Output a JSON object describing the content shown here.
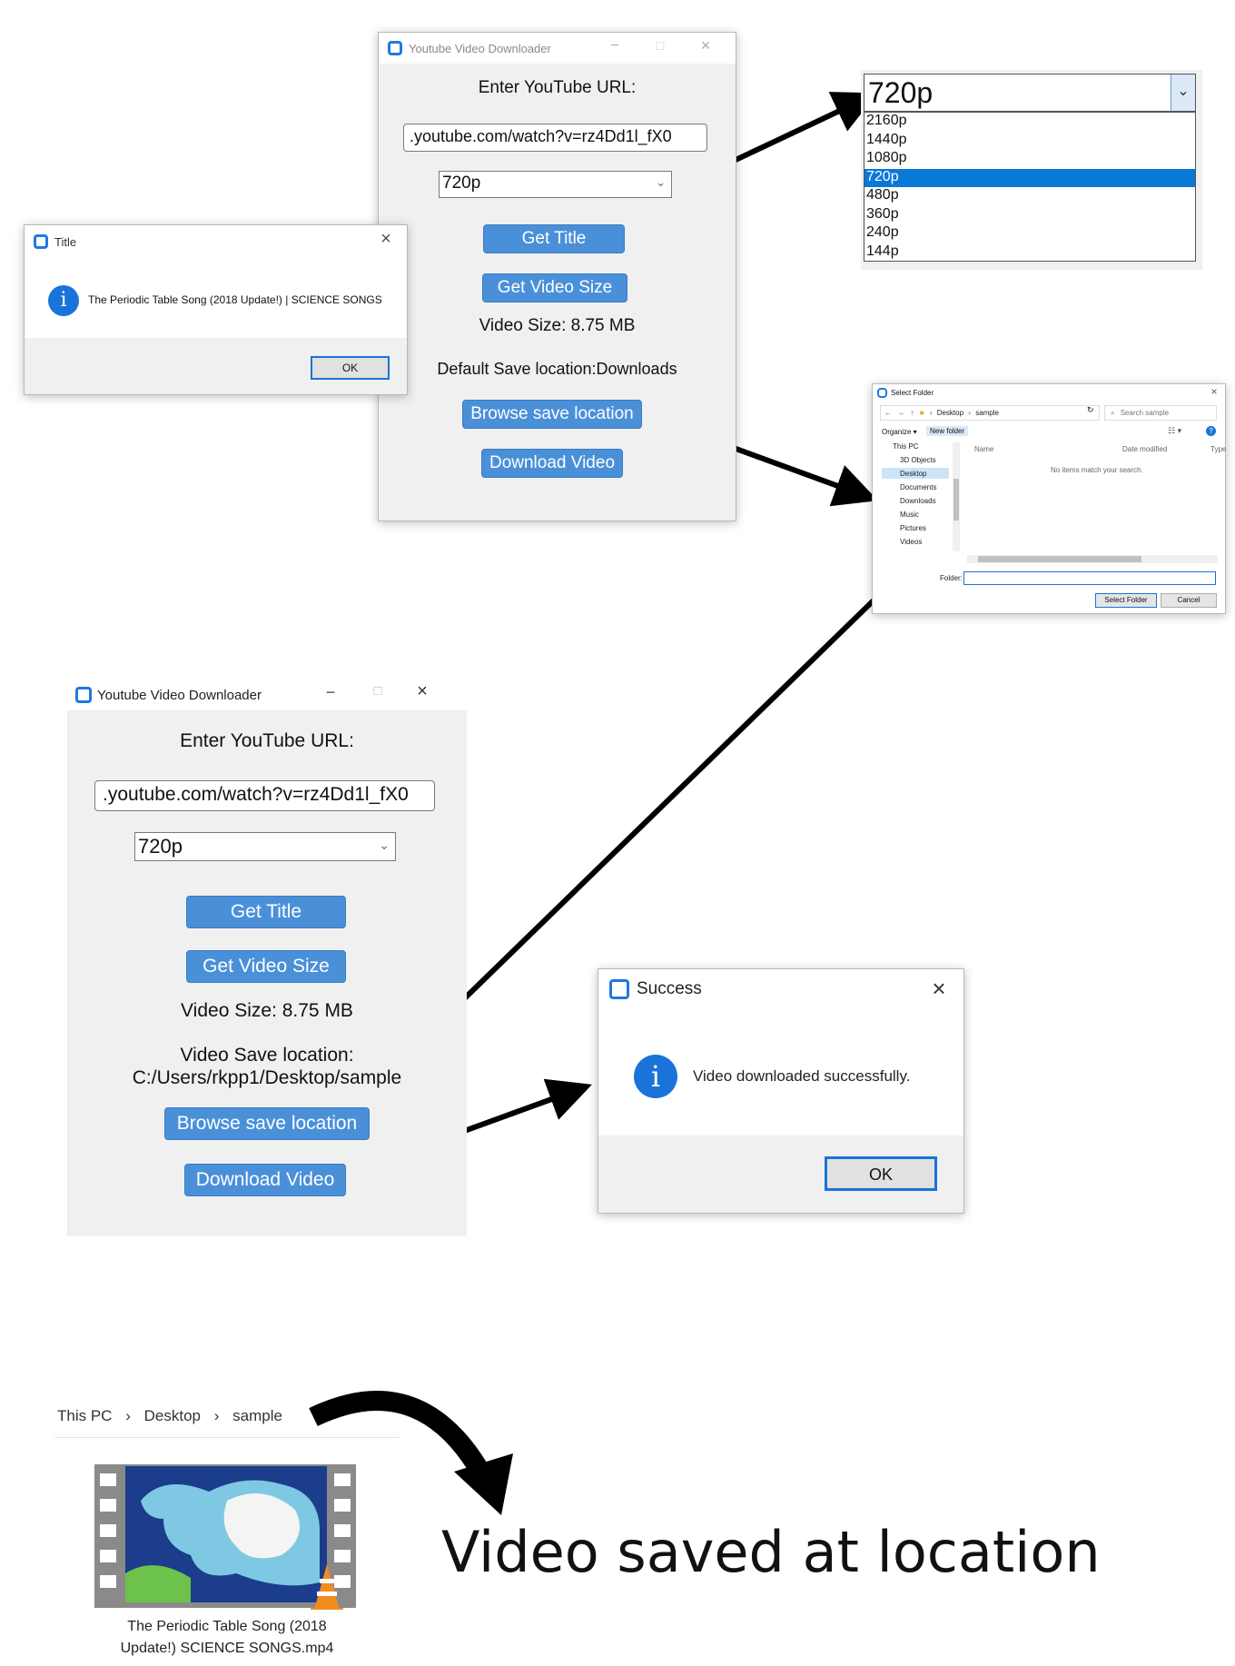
{
  "app": {
    "title": "Youtube Video Downloader",
    "url_prompt": "Enter YouTube URL:",
    "url_value": ".youtube.com/watch?v=rz4Dd1l_fX0",
    "quality": "720p",
    "get_title": "Get Title",
    "get_size": "Get Video Size",
    "size_text": "Video Size: 8.75 MB",
    "default_save": "Default Save location:Downloads",
    "browse": "Browse save location",
    "download": "Download Video",
    "save_label": "Video Save location:",
    "save_path": "C:/Users/rkpp1/Desktop/sample"
  },
  "dropdown": {
    "selected": "720p",
    "options": [
      "2160p",
      "1440p",
      "1080p",
      "720p",
      "480p",
      "360p",
      "240p",
      "144p"
    ]
  },
  "title_dialog": {
    "title": "Title",
    "message": "The Periodic Table Song (2018 Update!) | SCIENCE SONGS",
    "ok": "OK",
    "close": "×"
  },
  "folder_dialog": {
    "title": "Select Folder",
    "path": [
      "Desktop",
      "sample"
    ],
    "search_placeholder": "Search sample",
    "organize": "Organize ▾",
    "new_folder": "New folder",
    "tree": [
      "This PC",
      "3D Objects",
      "Desktop",
      "Documents",
      "Downloads",
      "Music",
      "Pictures",
      "Videos"
    ],
    "columns": [
      "Name",
      "Date modified",
      "Type"
    ],
    "empty": "No items match your search.",
    "folder_label": "Folder:",
    "select": "Select Folder",
    "cancel": "Cancel"
  },
  "success_dialog": {
    "title": "Success",
    "message": "Video downloaded successfully.",
    "ok": "OK",
    "close": "×"
  },
  "explorer": {
    "breadcrumb": [
      "This PC",
      "Desktop",
      "sample"
    ],
    "file_line1": "The Periodic Table Song (2018",
    "file_line2": "Update!)  SCIENCE SONGS.mp4"
  },
  "caption": "Video saved at location",
  "colors": {
    "button": "#4a90d9",
    "accent": "#1a73d9"
  }
}
